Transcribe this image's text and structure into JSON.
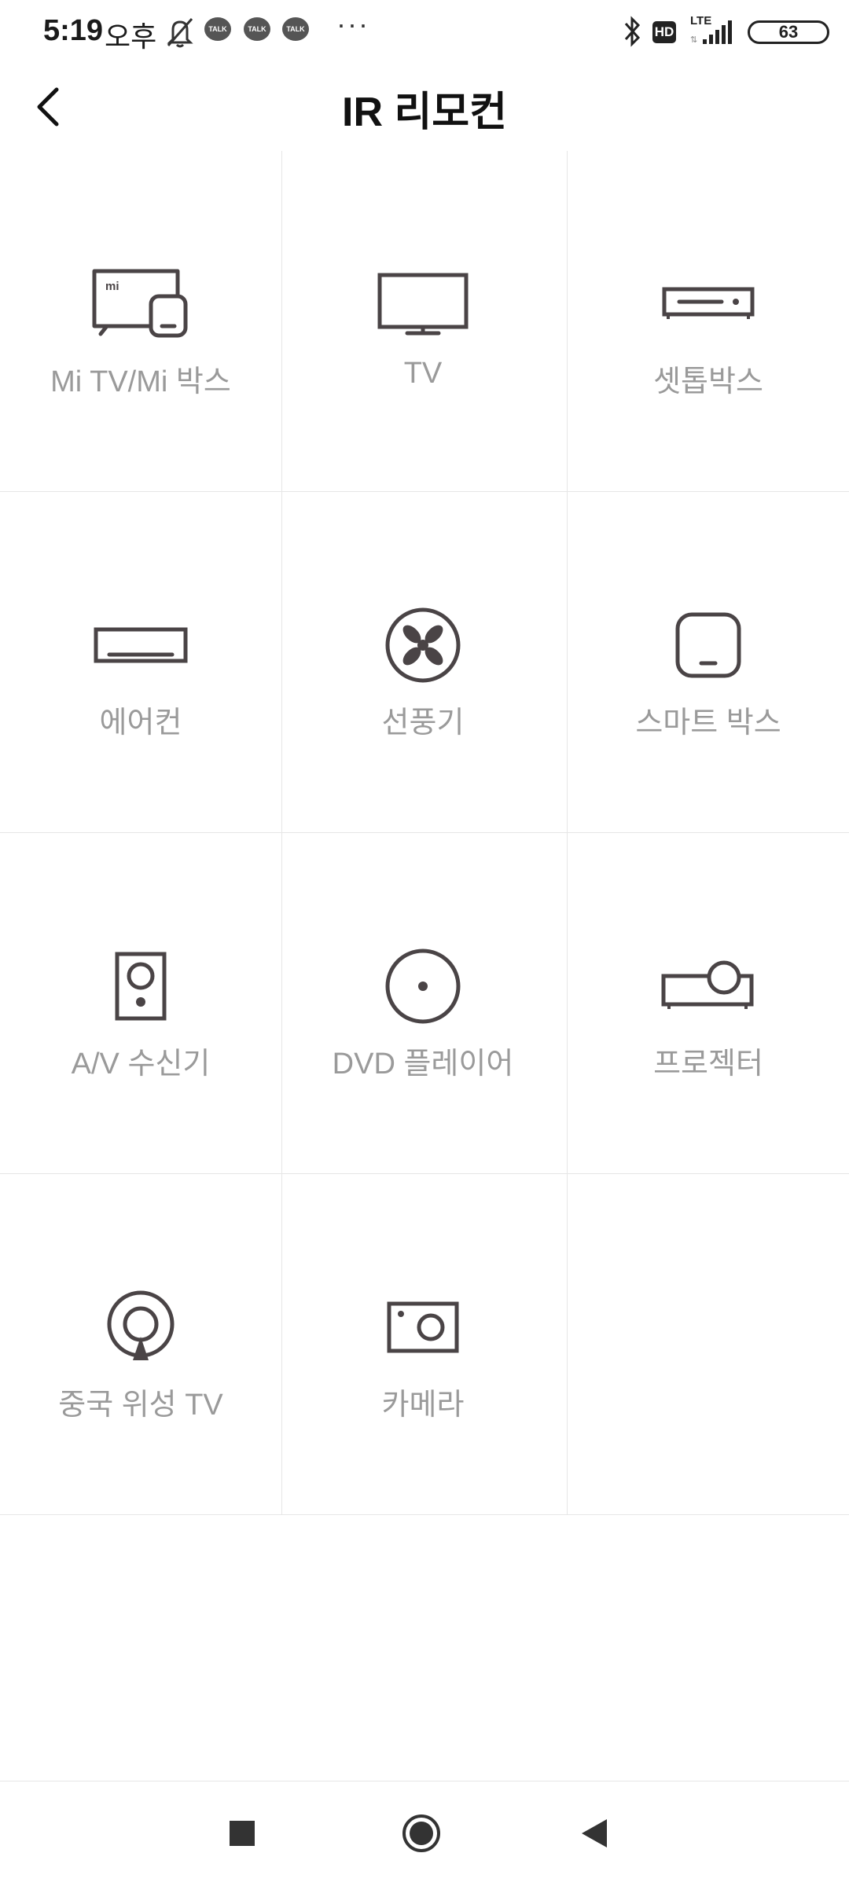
{
  "status_bar": {
    "time": "5:19",
    "ampm": "오후",
    "notification_badges": [
      "TALK",
      "TALK",
      "TALK"
    ],
    "more": "···",
    "network_hd": "HD",
    "network_type": "LTE",
    "battery": "63"
  },
  "header": {
    "title": "IR 리모컨"
  },
  "devices": [
    {
      "label": "Mi TV/Mi 박스",
      "icon": "mi-tv-box-icon"
    },
    {
      "label": "TV",
      "icon": "tv-icon"
    },
    {
      "label": "셋톱박스",
      "icon": "set-top-box-icon"
    },
    {
      "label": "에어컨",
      "icon": "air-conditioner-icon"
    },
    {
      "label": "선풍기",
      "icon": "fan-icon"
    },
    {
      "label": "스마트 박스",
      "icon": "smart-box-icon"
    },
    {
      "label": "A/V 수신기",
      "icon": "av-receiver-icon"
    },
    {
      "label": "DVD 플레이어",
      "icon": "dvd-player-icon"
    },
    {
      "label": "프로젝터",
      "icon": "projector-icon"
    },
    {
      "label": "중국 위성 TV",
      "icon": "satellite-tv-icon"
    },
    {
      "label": "카메라",
      "icon": "camera-icon"
    }
  ],
  "nav_bar": {
    "buttons": [
      "recents-button",
      "home-button",
      "back-button"
    ]
  },
  "colors": {
    "icon": "#4a4446",
    "label": "#9a9a9a",
    "divider": "#e6e6e6"
  }
}
